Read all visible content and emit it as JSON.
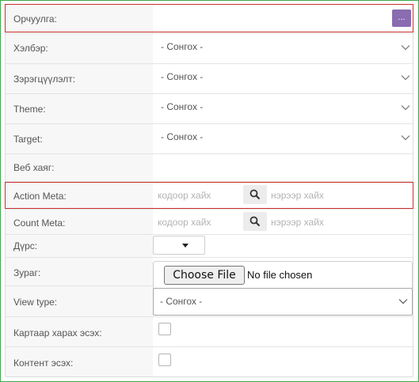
{
  "fields": {
    "orchuulga": {
      "label": "Орчуулга:",
      "button_label": "..."
    },
    "helber": {
      "label": "Хэлбэр:",
      "value": "- Сонгох -"
    },
    "zeregtsuulelt": {
      "label": "Зэрэгцүүлэлт:",
      "value": "- Сонгох -"
    },
    "theme": {
      "label": "Theme:",
      "value": "- Сонгох -"
    },
    "target": {
      "label": "Target:",
      "value": "- Сонгох -"
    },
    "web_hayag": {
      "label": "Веб хаяг:"
    },
    "action_meta": {
      "label": "Action Meta:",
      "code_placeholder": "кодоор хайх",
      "name_placeholder": "нэрээр хайх"
    },
    "count_meta": {
      "label": "Count Meta:",
      "code_placeholder": "кодоор хайх",
      "name_placeholder": "нэрээр хайх"
    },
    "durs": {
      "label": "Дүрс:"
    },
    "zurag": {
      "label": "Зураг:",
      "button_label": "Choose File",
      "status": "No file chosen"
    },
    "view_type": {
      "label": "View type:",
      "value": "- Сонгох -"
    },
    "kartaar": {
      "label": "Картаар харах эсэх:",
      "checked": false
    },
    "kontent": {
      "label": "Контент эсэх:",
      "checked": false
    }
  },
  "colors": {
    "frame": "#3fa84a",
    "highlight": "#c9302c",
    "accent_button": "#8a6cb0",
    "label_bg": "#f7f7f7"
  },
  "icons": {
    "dropdown": "chevron-down-icon",
    "search": "search-icon",
    "caret": "caret-down-icon"
  }
}
